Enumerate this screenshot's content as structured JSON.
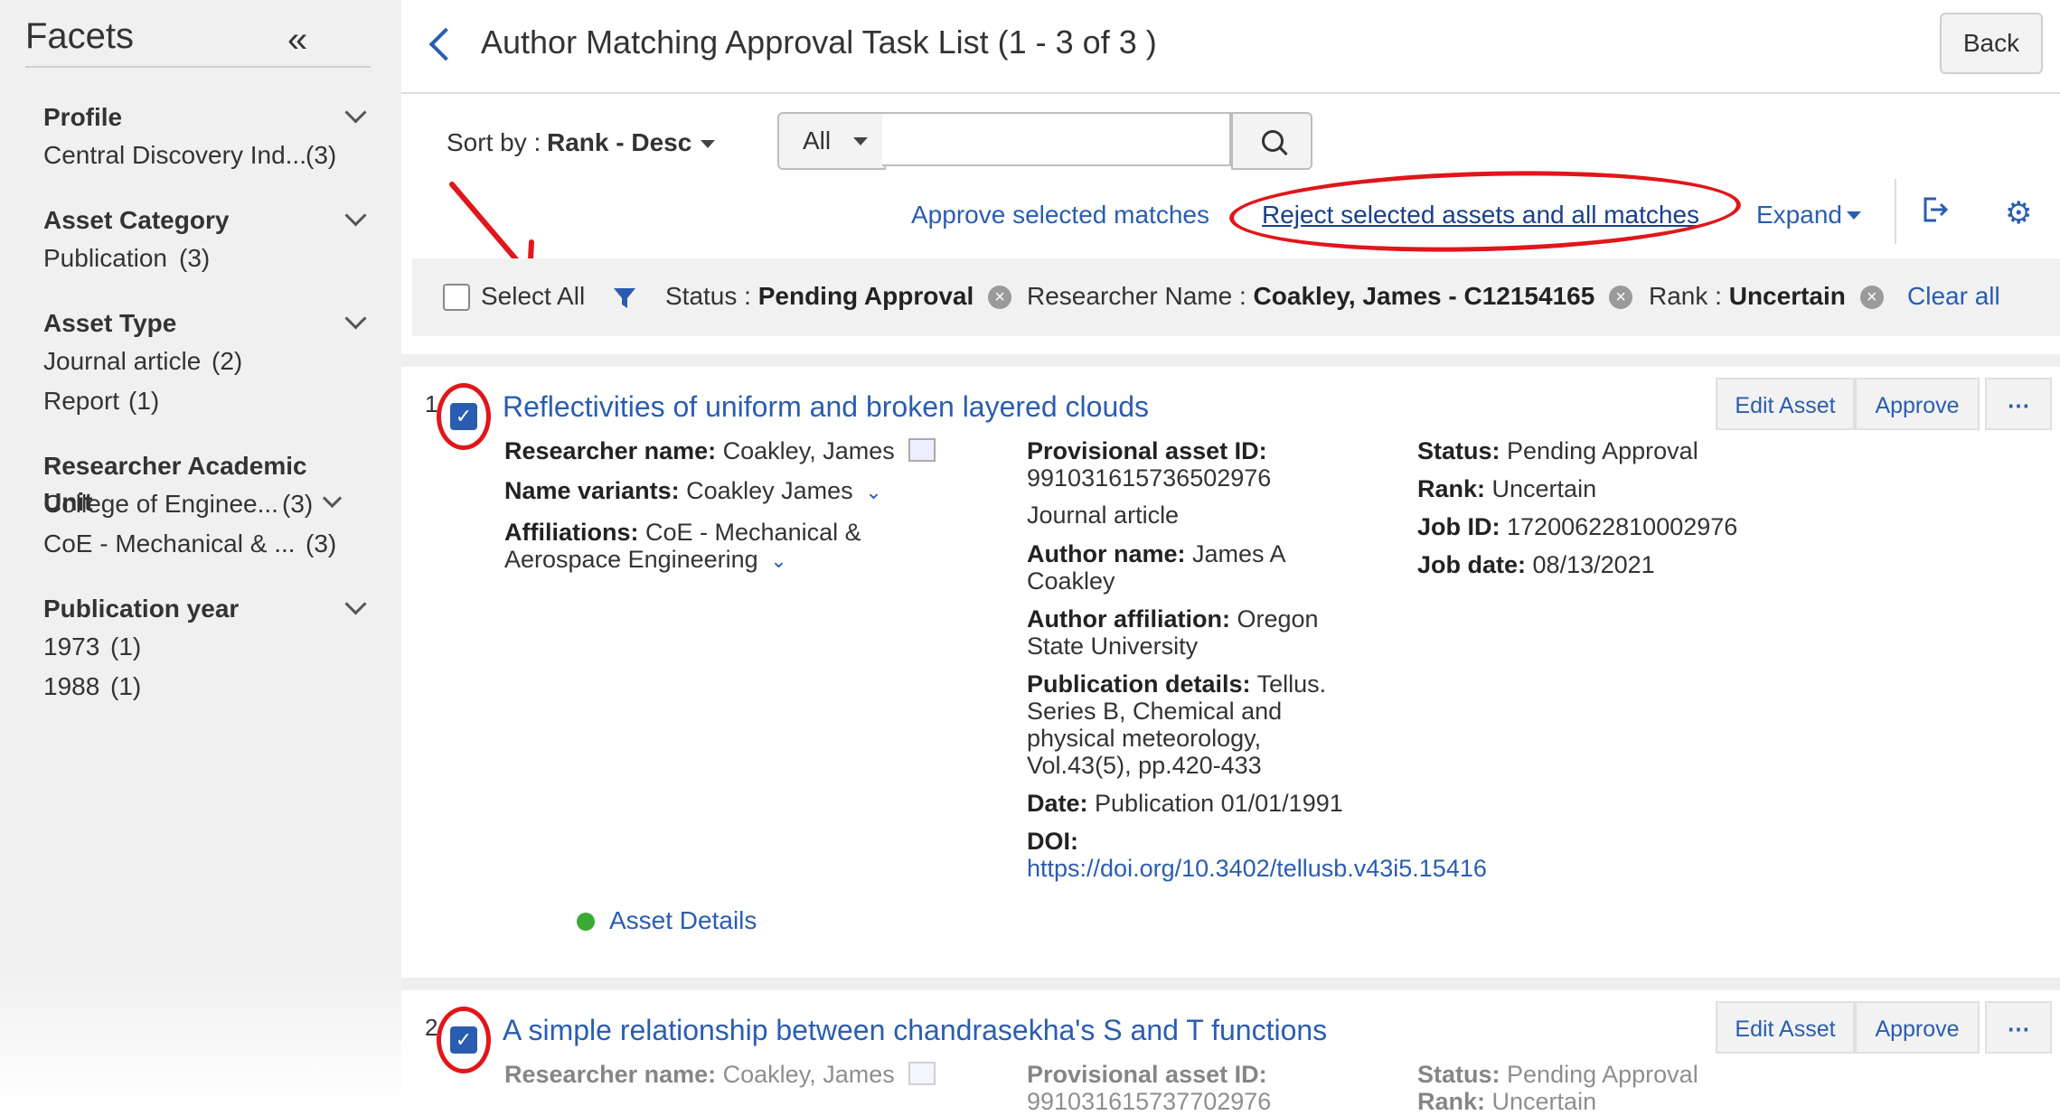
{
  "sidebar": {
    "title": "Facets",
    "groups": [
      {
        "label": "Profile",
        "items": [
          {
            "name": "Central Discovery Ind...",
            "count": "(3)"
          }
        ]
      },
      {
        "label": "Asset Category",
        "items": [
          {
            "name": "Publication",
            "count": "(3)"
          }
        ]
      },
      {
        "label": "Asset Type",
        "items": [
          {
            "name": "Journal article",
            "count": "(2)"
          },
          {
            "name": "Report",
            "count": "(1)"
          }
        ]
      },
      {
        "label": "Researcher Academic Unit",
        "items": [
          {
            "name": "College of Enginee...",
            "count": "(3)"
          },
          {
            "name": "CoE - Mechanical & ...",
            "count": "(3)"
          }
        ]
      },
      {
        "label": "Publication year",
        "items": [
          {
            "name": "1973",
            "count": "(1)"
          },
          {
            "name": "1988",
            "count": "(1)"
          }
        ]
      }
    ]
  },
  "header": {
    "title": "Author Matching Approval Task List (1 - 3 of 3 )",
    "back_label": "Back"
  },
  "toolbar": {
    "sort_label": "Sort by :",
    "sort_value": "Rank - Desc",
    "scope_value": "All",
    "search_value": "",
    "approve_selected": "Approve selected matches",
    "reject_selected": "Reject selected assets and all matches",
    "expand_label": "Expand"
  },
  "filters": {
    "select_all": "Select All",
    "chips": [
      {
        "key": "Status :",
        "value": "Pending Approval"
      },
      {
        "key": "Researcher Name :",
        "value": "Coakley, James - C12154165"
      },
      {
        "key": "Rank :",
        "value": "Uncertain"
      }
    ],
    "clear_all": "Clear all"
  },
  "results": [
    {
      "rank": "1",
      "title": "Reflectivities of uniform and broken layered clouds",
      "researcher_label": "Researcher name:",
      "researcher": "Coakley, James",
      "variants_label": "Name variants:",
      "variants": "Coakley James",
      "affil_label": "Affiliations:",
      "affil_line1": "CoE - Mechanical &",
      "affil_line2": "Aerospace Engineering",
      "prov_label": "Provisional asset ID:",
      "prov_id": "991031615736502976",
      "asset_type": "Journal article",
      "author_label": "Author name:",
      "author_line1": "James A",
      "author_line2": "Coakley",
      "author_affil_label": "Author affiliation:",
      "author_affil_line1": "Oregon",
      "author_affil_line2": "State University",
      "pub_label": "Publication details:",
      "pub_line1": "Tellus.",
      "pub_line2": "Series B, Chemical and",
      "pub_line3": "physical meteorology,",
      "pub_line4": "Vol.43(5), pp.420-433",
      "date_label": "Date:",
      "date": "Publication 01/01/1991",
      "doi_label": "DOI:",
      "doi": "https://doi.org/10.3402/tellusb.v43i5.15416",
      "status_label": "Status:",
      "status": "Pending Approval",
      "rank_label": "Rank:",
      "rank_value": "Uncertain",
      "job_label": "Job ID:",
      "job_id": "17200622810002976",
      "jobdate_label": "Job date:",
      "job_date": "08/13/2021",
      "asset_details": "Asset Details",
      "edit_label": "Edit Asset",
      "approve_label": "Approve",
      "more_label": "⋯"
    },
    {
      "rank": "2",
      "title": "A simple relationship between chandrasekha's S and T functions",
      "researcher_label": "Researcher name:",
      "researcher": "Coakley, James",
      "prov_label": "Provisional asset ID:",
      "prov_id": "991031615737702976",
      "status_label": "Status:",
      "status": "Pending Approval",
      "rank_label": "Rank:",
      "rank_value": "Uncertain",
      "edit_label": "Edit Asset",
      "approve_label": "Approve",
      "more_label": "⋯"
    }
  ],
  "colors": {
    "link": "#2a5db0",
    "annotation": "#e0161b",
    "checkbox": "#2a5db0",
    "status_dot": "#3aaa35"
  },
  "icons": [
    "double-chevron-left-icon",
    "back-arrow-icon",
    "search-icon",
    "export-icon",
    "gear-icon",
    "funnel-icon",
    "remove-chip-icon",
    "more-options-icon",
    "profile-card-icon",
    "expand-chevron-icon"
  ]
}
